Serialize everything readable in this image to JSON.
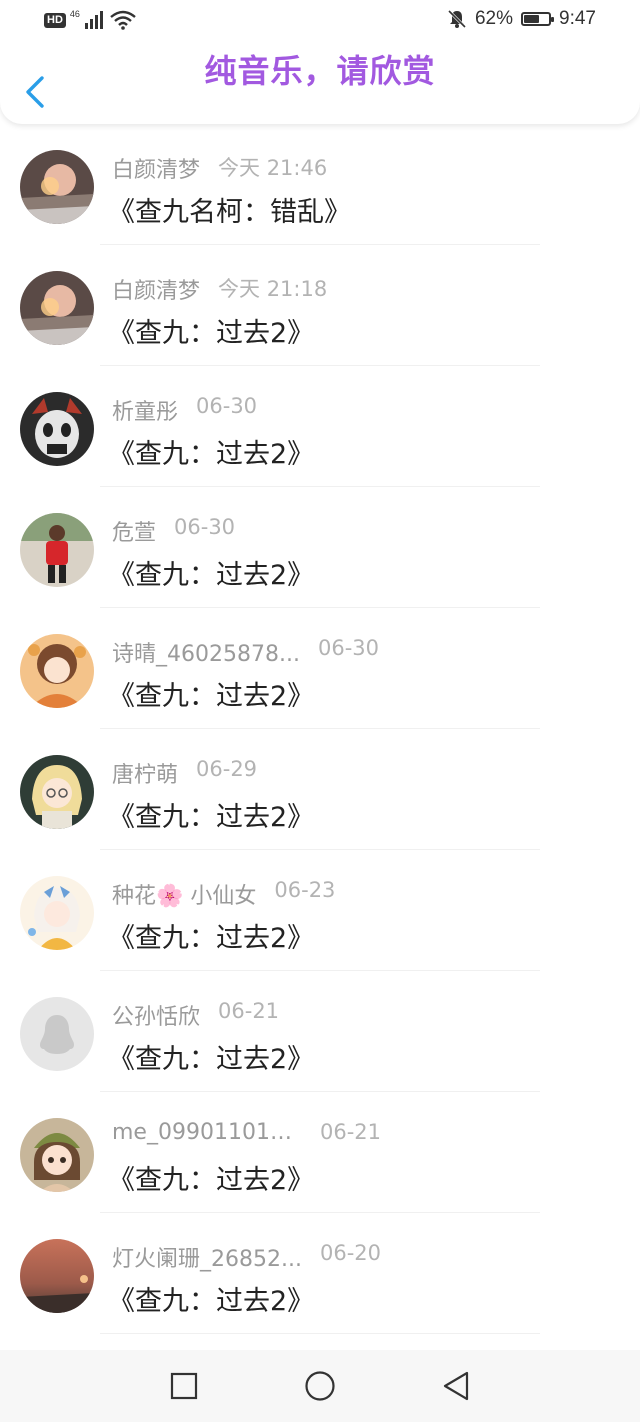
{
  "status_bar": {
    "hd": "HD",
    "network": "46",
    "battery_percent": "62%",
    "battery_level": 0.62,
    "time": "9:47"
  },
  "header": {
    "title": "纯音乐，请欣赏",
    "title_color": "#a259e0",
    "back_icon": "chevron-left-icon",
    "accent": "#2a9ee8"
  },
  "list": [
    {
      "name": "白颜清梦",
      "time": "今天 21:46",
      "title": "《查九名柯：错乱》",
      "avatar": "photo-hand-light"
    },
    {
      "name": "白颜清梦",
      "time": "今天 21:18",
      "title": "《查九：过去2》",
      "avatar": "photo-hand-light"
    },
    {
      "name": "析童彤",
      "time": "06-30",
      "title": "《查九：过去2》",
      "avatar": "dark-mask"
    },
    {
      "name": "危萱",
      "time": "06-30",
      "title": "《查九：过去2》",
      "avatar": "person-red-jacket"
    },
    {
      "name": "诗晴_46025878...",
      "time": "06-30",
      "title": "《查九：过去2》",
      "avatar": "anime-girl-orange"
    },
    {
      "name": "唐柠萌",
      "time": "06-29",
      "title": "《查九：过去2》",
      "avatar": "anime-blonde-glasses"
    },
    {
      "name": "种花🌸 小仙女",
      "time": "06-23",
      "title": "《查九：过去2》",
      "avatar": "anime-girl-blue-bow"
    },
    {
      "name": "公孙恬欣",
      "time": "06-21",
      "title": "《查九：过去2》",
      "avatar": "default-penguin"
    },
    {
      "name": "me_099011018...",
      "time": "06-21",
      "title": "《查九：过去2》",
      "avatar": "doll-green-hat"
    },
    {
      "name": "灯火阑珊_26852...",
      "time": "06-20",
      "title": "《查九：过去2》",
      "avatar": "sunset-photo"
    }
  ],
  "navbar": {
    "icons": [
      "square-icon",
      "circle-home-icon",
      "triangle-back-icon"
    ]
  }
}
